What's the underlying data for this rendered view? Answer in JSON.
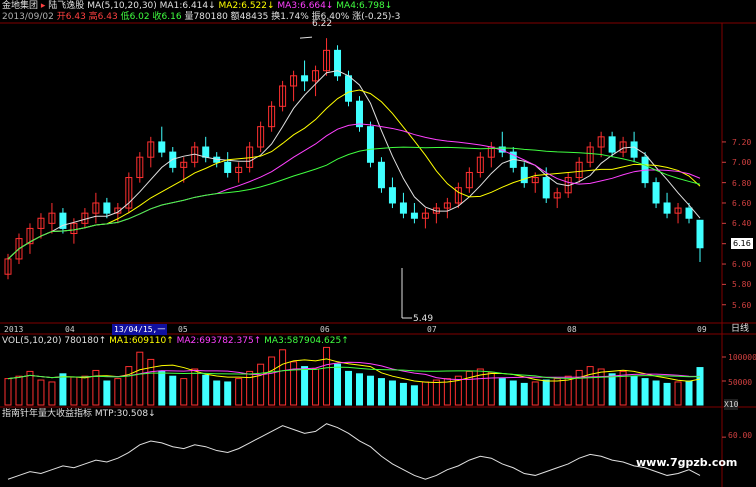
{
  "header": {
    "name": "金地集团",
    "company": "陆飞逸股",
    "ma_label": "MA(5,10,20,30)",
    "ma1": "MA1:6.414",
    "ma2": "MA2:6.522",
    "ma3": "MA3:6.664",
    "ma4": "MA4:6.798",
    "date": "2013/09/02",
    "open": "开6.43",
    "high": "高6.43",
    "low": "低6.02",
    "close": "收6.16",
    "volume": "量780180",
    "amount": "额48435",
    "turnover": "换1.74%",
    "amplitude": "振6.40%",
    "change": "涨(-0.25)-3"
  },
  "price_axis": [
    "7.20",
    "7.00",
    "6.80",
    "6.60",
    "6.40",
    "6.20",
    "6.00",
    "5.80",
    "5.60"
  ],
  "current_price_tag": "6.16",
  "annotations": {
    "high": "6.22",
    "low": "5.49"
  },
  "date_axis": [
    "2013",
    "04",
    "13/04/15,一",
    "05",
    "06",
    "07",
    "08",
    "09"
  ],
  "period_label": "日线",
  "volume_panel": {
    "label": "VOL(5,10,20)",
    "vol": "780180",
    "ma1": "MA1:609110",
    "ma2": "MA2:693782.375",
    "ma3": "MA3:587904.625",
    "axis": [
      "100000",
      "50000"
    ],
    "unit": "X10"
  },
  "indicator_panel": {
    "label": "指南针年量大收益指标",
    "value": "MTP:30.508",
    "axis_value": "60.00"
  },
  "watermark": "www.7gpzb.com",
  "colors": {
    "up": "#ff3030",
    "down": "#40ffff",
    "ma5": "#e0e0e0",
    "ma10": "#ffff00",
    "ma20": "#ff40ff",
    "ma30": "#40ff40"
  },
  "chart_data": {
    "type": "candlestick",
    "ylim": [
      5.49,
      7.3
    ],
    "candles": [
      [
        5.9,
        6.1,
        5.85,
        6.05
      ],
      [
        6.05,
        6.3,
        6.0,
        6.25
      ],
      [
        6.2,
        6.4,
        6.1,
        6.35
      ],
      [
        6.35,
        6.5,
        6.25,
        6.45
      ],
      [
        6.4,
        6.6,
        6.3,
        6.5
      ],
      [
        6.5,
        6.55,
        6.3,
        6.35
      ],
      [
        6.3,
        6.45,
        6.2,
        6.4
      ],
      [
        6.4,
        6.55,
        6.35,
        6.5
      ],
      [
        6.5,
        6.7,
        6.4,
        6.6
      ],
      [
        6.6,
        6.65,
        6.45,
        6.5
      ],
      [
        6.5,
        6.6,
        6.4,
        6.55
      ],
      [
        6.55,
        6.9,
        6.5,
        6.85
      ],
      [
        6.85,
        7.1,
        6.8,
        7.05
      ],
      [
        7.05,
        7.25,
        6.95,
        7.2
      ],
      [
        7.2,
        7.35,
        7.05,
        7.1
      ],
      [
        7.1,
        7.15,
        6.9,
        6.95
      ],
      [
        6.95,
        7.05,
        6.8,
        7.0
      ],
      [
        7.0,
        7.2,
        6.95,
        7.15
      ],
      [
        7.15,
        7.25,
        7.0,
        7.05
      ],
      [
        7.05,
        7.1,
        6.95,
        7.0
      ],
      [
        7.0,
        7.1,
        6.85,
        6.9
      ],
      [
        6.9,
        7.0,
        6.8,
        6.95
      ],
      [
        6.95,
        7.2,
        6.9,
        7.15
      ],
      [
        7.15,
        7.4,
        7.1,
        7.35
      ],
      [
        7.35,
        7.6,
        7.3,
        7.55
      ],
      [
        7.55,
        7.8,
        7.5,
        7.75
      ],
      [
        7.75,
        7.9,
        7.6,
        7.85
      ],
      [
        7.85,
        8.0,
        7.7,
        7.8
      ],
      [
        7.8,
        7.95,
        7.65,
        7.9
      ],
      [
        7.9,
        8.22,
        7.85,
        8.1
      ],
      [
        8.1,
        8.15,
        7.8,
        7.85
      ],
      [
        7.85,
        7.9,
        7.55,
        7.6
      ],
      [
        7.6,
        7.65,
        7.3,
        7.35
      ],
      [
        7.35,
        7.4,
        6.95,
        7.0
      ],
      [
        7.0,
        7.05,
        6.7,
        6.75
      ],
      [
        6.75,
        6.85,
        6.55,
        6.6
      ],
      [
        6.6,
        6.7,
        6.45,
        6.5
      ],
      [
        6.5,
        6.6,
        6.4,
        6.45
      ],
      [
        6.45,
        6.55,
        6.35,
        6.5
      ],
      [
        6.5,
        6.6,
        6.4,
        6.55
      ],
      [
        6.55,
        6.65,
        6.45,
        6.6
      ],
      [
        6.6,
        6.8,
        6.55,
        6.75
      ],
      [
        6.75,
        6.95,
        6.7,
        6.9
      ],
      [
        6.9,
        7.1,
        6.85,
        7.05
      ],
      [
        7.05,
        7.2,
        6.95,
        7.15
      ],
      [
        7.15,
        7.3,
        7.05,
        7.1
      ],
      [
        7.1,
        7.15,
        6.9,
        6.95
      ],
      [
        6.95,
        7.0,
        6.75,
        6.8
      ],
      [
        6.8,
        6.9,
        6.7,
        6.85
      ],
      [
        6.85,
        6.95,
        6.6,
        6.65
      ],
      [
        6.65,
        6.75,
        6.55,
        6.7
      ],
      [
        6.7,
        6.9,
        6.65,
        6.85
      ],
      [
        6.85,
        7.05,
        6.8,
        7.0
      ],
      [
        7.0,
        7.2,
        6.95,
        7.15
      ],
      [
        7.15,
        7.3,
        7.05,
        7.25
      ],
      [
        7.25,
        7.3,
        7.05,
        7.1
      ],
      [
        7.1,
        7.25,
        7.05,
        7.2
      ],
      [
        7.2,
        7.3,
        7.0,
        7.05
      ],
      [
        7.05,
        7.1,
        6.75,
        6.8
      ],
      [
        6.8,
        6.85,
        6.55,
        6.6
      ],
      [
        6.6,
        6.7,
        6.45,
        6.5
      ],
      [
        6.5,
        6.6,
        6.4,
        6.55
      ],
      [
        6.55,
        6.6,
        6.4,
        6.45
      ],
      [
        6.43,
        6.43,
        6.02,
        6.16
      ]
    ],
    "volume": [
      55,
      60,
      70,
      52,
      48,
      65,
      58,
      60,
      72,
      50,
      55,
      80,
      110,
      95,
      70,
      60,
      55,
      75,
      62,
      50,
      48,
      55,
      70,
      85,
      100,
      115,
      90,
      80,
      75,
      120,
      85,
      70,
      65,
      60,
      55,
      50,
      45,
      40,
      48,
      52,
      55,
      60,
      70,
      75,
      68,
      55,
      50,
      45,
      48,
      52,
      55,
      60,
      72,
      80,
      75,
      65,
      70,
      60,
      55,
      50,
      45,
      48,
      50,
      78
    ],
    "mtp": [
      38,
      40,
      42,
      41,
      43,
      45,
      44,
      46,
      48,
      47,
      49,
      52,
      56,
      58,
      57,
      55,
      54,
      56,
      55,
      53,
      52,
      54,
      57,
      60,
      63,
      66,
      64,
      62,
      63,
      67,
      65,
      62,
      58,
      55,
      50,
      46,
      43,
      40,
      38,
      40,
      43,
      45,
      48,
      50,
      49,
      46,
      44,
      41,
      40,
      42,
      44,
      46,
      49,
      51,
      50,
      48,
      47,
      45,
      44,
      42,
      40,
      41,
      43,
      40
    ]
  }
}
